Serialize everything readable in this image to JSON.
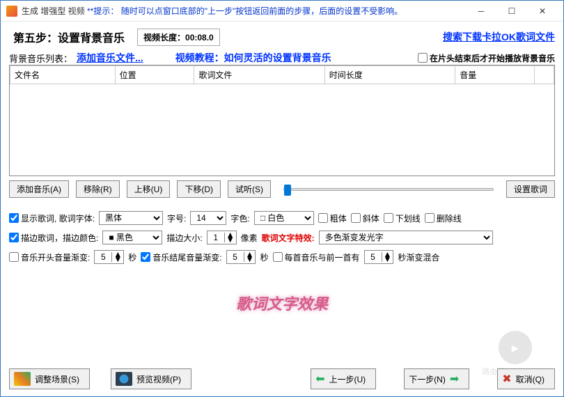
{
  "titlebar": {
    "app_prefix": "生成 增强型 视频 ",
    "hint_label": "**提示：",
    "hint_text": "随时可以点窗口底部的\"上一步\"按钮返回前面的步骤，后面的设置不受影响。"
  },
  "header": {
    "step_title": "第五步：设置背景音乐",
    "video_len_label": "视频长度：",
    "video_len_value": "00:08.0",
    "search_link": "搜索下载卡拉OK歌词文件"
  },
  "bgm": {
    "list_label": "背景音乐列表：",
    "add_file": "添加音乐文件...",
    "tutorial": "视频教程：如何灵活的设置背景音乐",
    "after_title_label": "在片头结束后才开始播放背景音乐"
  },
  "table": {
    "cols": [
      "文件名",
      "位置",
      "歌词文件",
      "时间长度",
      "音量"
    ]
  },
  "buttons": {
    "add": "添加音乐(A)",
    "remove": "移除(R)",
    "move_up": "上移(U)",
    "move_down": "下移(D)",
    "preview_audio": "试听(S)",
    "set_lyrics": "设置歌词"
  },
  "opts": {
    "show_lyrics": "显示歌词, 歌词字体:",
    "font": "黑体",
    "size_label": "字号:",
    "size": "14",
    "color_label": "字色:",
    "color": "白色",
    "bold": "粗体",
    "italic": "斜体",
    "underline": "下划线",
    "strike": "删除线",
    "outline_label": "描边歌词，描边颜色:",
    "outline_color": "黑色",
    "outline_size_label": "描边大小:",
    "outline_size": "1",
    "pixels": "像素",
    "effect_label": "歌词文字特效:",
    "effect": "多色渐变发光字",
    "fade_in_label": "音乐开头音量渐变:",
    "fade_in": "5",
    "sec": "秒",
    "fade_out_label": "音乐结尾音量渐变:",
    "fade_out": "5",
    "gap_label": "每首音乐与前一首有",
    "gap": "5",
    "gap_suffix": "秒渐变混合"
  },
  "preview_text": "歌词文字效果",
  "footer": {
    "adjust_scene": "调整场景(S)",
    "preview_video": "预览视频(P)",
    "prev": "上一步(U)",
    "next": "下一步(N)",
    "cancel": "取消(Q)"
  },
  "watermark": "路由器\nluyouqi.com"
}
